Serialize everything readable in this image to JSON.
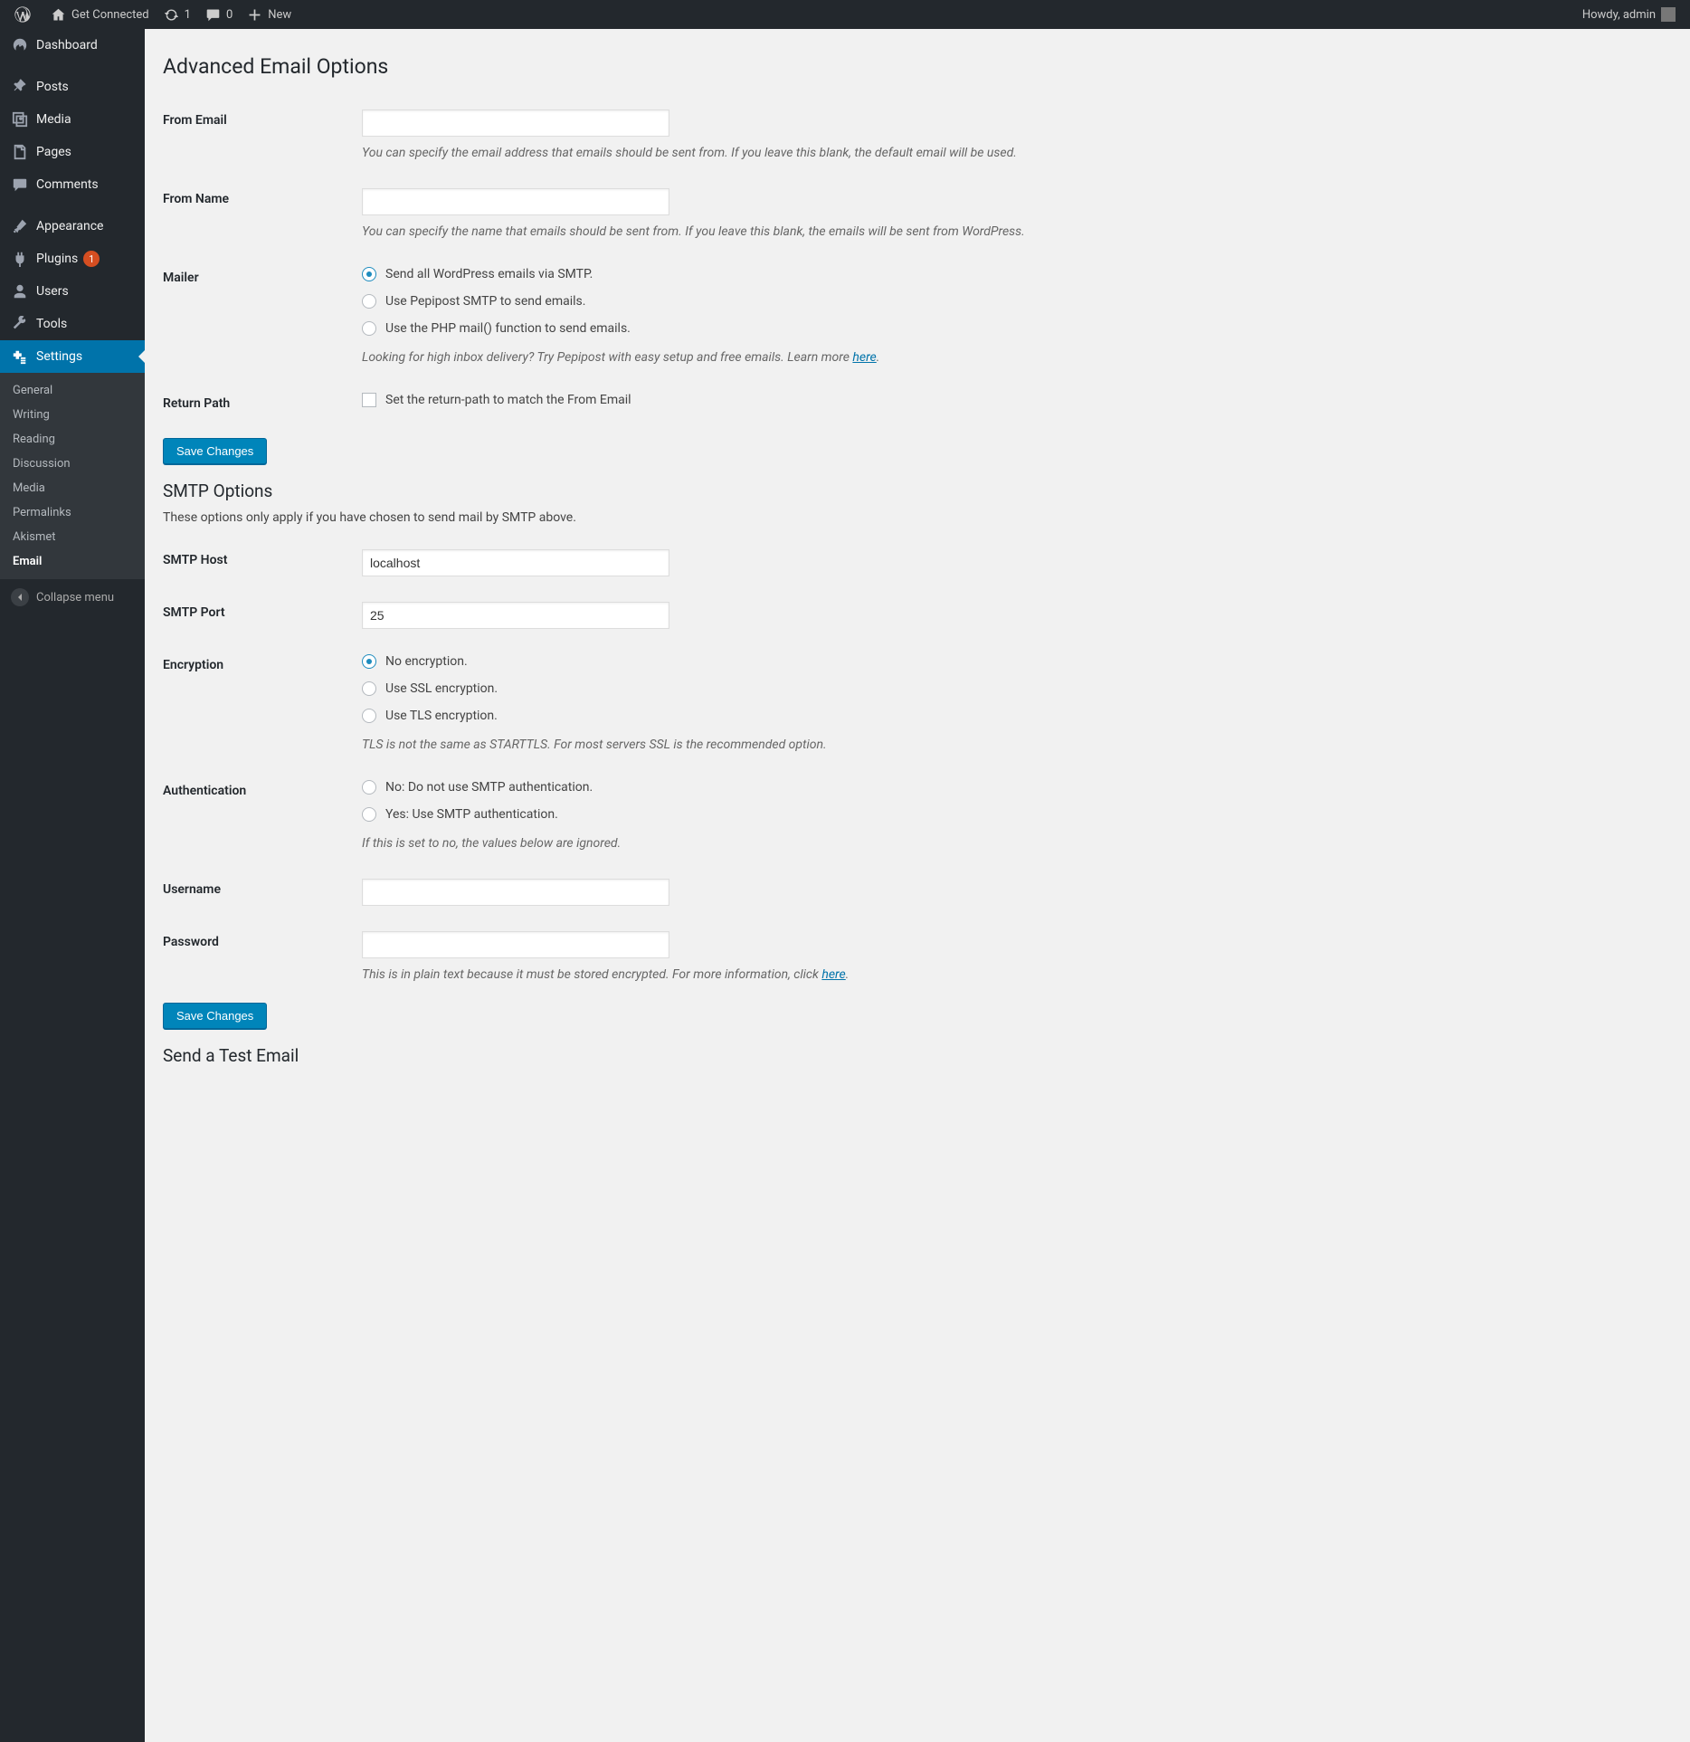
{
  "adminbar": {
    "site_name": "Get Connected",
    "updates_count": "1",
    "comments_count": "0",
    "new_label": "New",
    "howdy": "Howdy, admin"
  },
  "menu": {
    "dashboard": "Dashboard",
    "posts": "Posts",
    "media": "Media",
    "pages": "Pages",
    "comments": "Comments",
    "appearance": "Appearance",
    "plugins": "Plugins",
    "plugins_updates": "1",
    "users": "Users",
    "tools": "Tools",
    "settings": "Settings",
    "collapse": "Collapse menu"
  },
  "submenu": {
    "general": "General",
    "writing": "Writing",
    "reading": "Reading",
    "discussion": "Discussion",
    "media": "Media",
    "permalinks": "Permalinks",
    "akismet": "Akismet",
    "email": "Email"
  },
  "page": {
    "title": "Advanced Email Options",
    "save_button": "Save Changes",
    "fields": {
      "from_email": {
        "label": "From Email",
        "value": "",
        "desc": "You can specify the email address that emails should be sent from. If you leave this blank, the default email will be used."
      },
      "from_name": {
        "label": "From Name",
        "value": "",
        "desc": "You can specify the name that emails should be sent from. If you leave this blank, the emails will be sent from WordPress."
      },
      "mailer": {
        "label": "Mailer",
        "opt1": "Send all WordPress emails via SMTP.",
        "opt2": "Use Pepipost SMTP to send emails.",
        "opt3": "Use the PHP mail() function to send emails.",
        "desc_prefix": "Looking for high inbox delivery? Try Pepipost with easy setup and free emails. Learn more ",
        "desc_link": "here",
        "desc_suffix": "."
      },
      "return_path": {
        "label": "Return Path",
        "opt": "Set the return-path to match the From Email"
      }
    },
    "smtp": {
      "title": "SMTP Options",
      "intro": "These options only apply if you have chosen to send mail by SMTP above.",
      "host": {
        "label": "SMTP Host",
        "value": "localhost"
      },
      "port": {
        "label": "SMTP Port",
        "value": "25"
      },
      "encryption": {
        "label": "Encryption",
        "opt1": "No encryption.",
        "opt2": "Use SSL encryption.",
        "opt3": "Use TLS encryption.",
        "desc": "TLS is not the same as STARTTLS. For most servers SSL is the recommended option."
      },
      "auth": {
        "label": "Authentication",
        "opt1": "No: Do not use SMTP authentication.",
        "opt2": "Yes: Use SMTP authentication.",
        "desc": "If this is set to no, the values below are ignored."
      },
      "username": {
        "label": "Username",
        "value": ""
      },
      "password": {
        "label": "Password",
        "value": "",
        "desc_prefix": "This is in plain text because it must be stored encrypted. For more information, click ",
        "desc_link": "here",
        "desc_suffix": "."
      }
    },
    "test": {
      "title": "Send a Test Email"
    }
  }
}
